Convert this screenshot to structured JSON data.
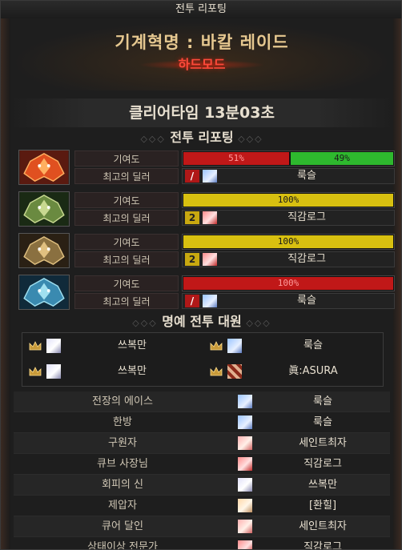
{
  "window": {
    "title": "전투 리포팅"
  },
  "header": {
    "boss_title": "기계혁명 : 바칼 레이드",
    "mode": "하드모드"
  },
  "clear_time": "클리어타임 13분03초",
  "report_section": {
    "title": "전투 리포팅"
  },
  "bosses": [
    {
      "icon": "red-dragon-emblem-icon",
      "contribution_label": "기여도",
      "dealer_label": "최고의 딜러",
      "bars": [
        {
          "text": "51%",
          "value": 51,
          "color": "#c01818"
        },
        {
          "text": "49%",
          "value": 49,
          "color": "#2eb82e"
        }
      ],
      "dealer": {
        "class_icon": "slash-class-icon",
        "avatar": "blue-hair-avatar",
        "name": "룩슬"
      }
    },
    {
      "icon": "green-dragon-emblem-icon",
      "contribution_label": "기여도",
      "dealer_label": "최고의 딜러",
      "bars": [
        {
          "text": "100%",
          "value": 100,
          "color": "#d8c010"
        }
      ],
      "dealer": {
        "class_icon": "number-two-class-icon",
        "avatar": "red-hair-avatar",
        "name": "직감로그"
      }
    },
    {
      "icon": "gold-dragon-emblem-icon",
      "contribution_label": "기여도",
      "dealer_label": "최고의 딜러",
      "bars": [
        {
          "text": "100%",
          "value": 100,
          "color": "#d8c010"
        }
      ],
      "dealer": {
        "class_icon": "number-two-class-icon",
        "avatar": "red-hair-avatar",
        "name": "직감로그"
      }
    },
    {
      "icon": "blue-dragon-emblem-icon",
      "contribution_label": "기여도",
      "dealer_label": "최고의 딜러",
      "bars": [
        {
          "text": "100%",
          "value": 100,
          "color": "#c01818"
        }
      ],
      "dealer": {
        "class_icon": "slash-class-icon",
        "avatar": "blue-hair-avatar",
        "name": "룩슬"
      }
    }
  ],
  "honor_section": {
    "title": "명예 전투 대원",
    "members": [
      {
        "crown": "crown-icon",
        "avatar": "white-hair-avatar",
        "name": "쓰복만"
      },
      {
        "crown": "crown-icon",
        "avatar": "blue-hair-avatar",
        "name": "룩슬"
      },
      {
        "crown": "crown-icon",
        "avatar": "white-hair-avatar",
        "name": "쓰복만"
      },
      {
        "crown": "crown-icon",
        "avatar": "pixel-avatar",
        "name": "眞:ASURA"
      }
    ]
  },
  "awards": [
    {
      "title": "전장의 에이스",
      "avatar": "blue-hair-avatar",
      "name": "룩슬"
    },
    {
      "title": "한방",
      "avatar": "blue-hair-avatar",
      "name": "룩슬"
    },
    {
      "title": "구원자",
      "avatar": "pink-hair-avatar",
      "name": "세인트최자"
    },
    {
      "title": "큐브 사장님",
      "avatar": "red-hair-avatar",
      "name": "직감로그"
    },
    {
      "title": "회피의 신",
      "avatar": "white-hair-avatar",
      "name": "쓰복만"
    },
    {
      "title": "제압자",
      "avatar": "pale-hair-avatar",
      "name": "[환힐]"
    },
    {
      "title": "큐어 달인",
      "avatar": "pink-hair-avatar",
      "name": "세인트최자"
    },
    {
      "title": "상태이상 전문가",
      "avatar": "red-hair-avatar",
      "name": "직감로그"
    }
  ]
}
